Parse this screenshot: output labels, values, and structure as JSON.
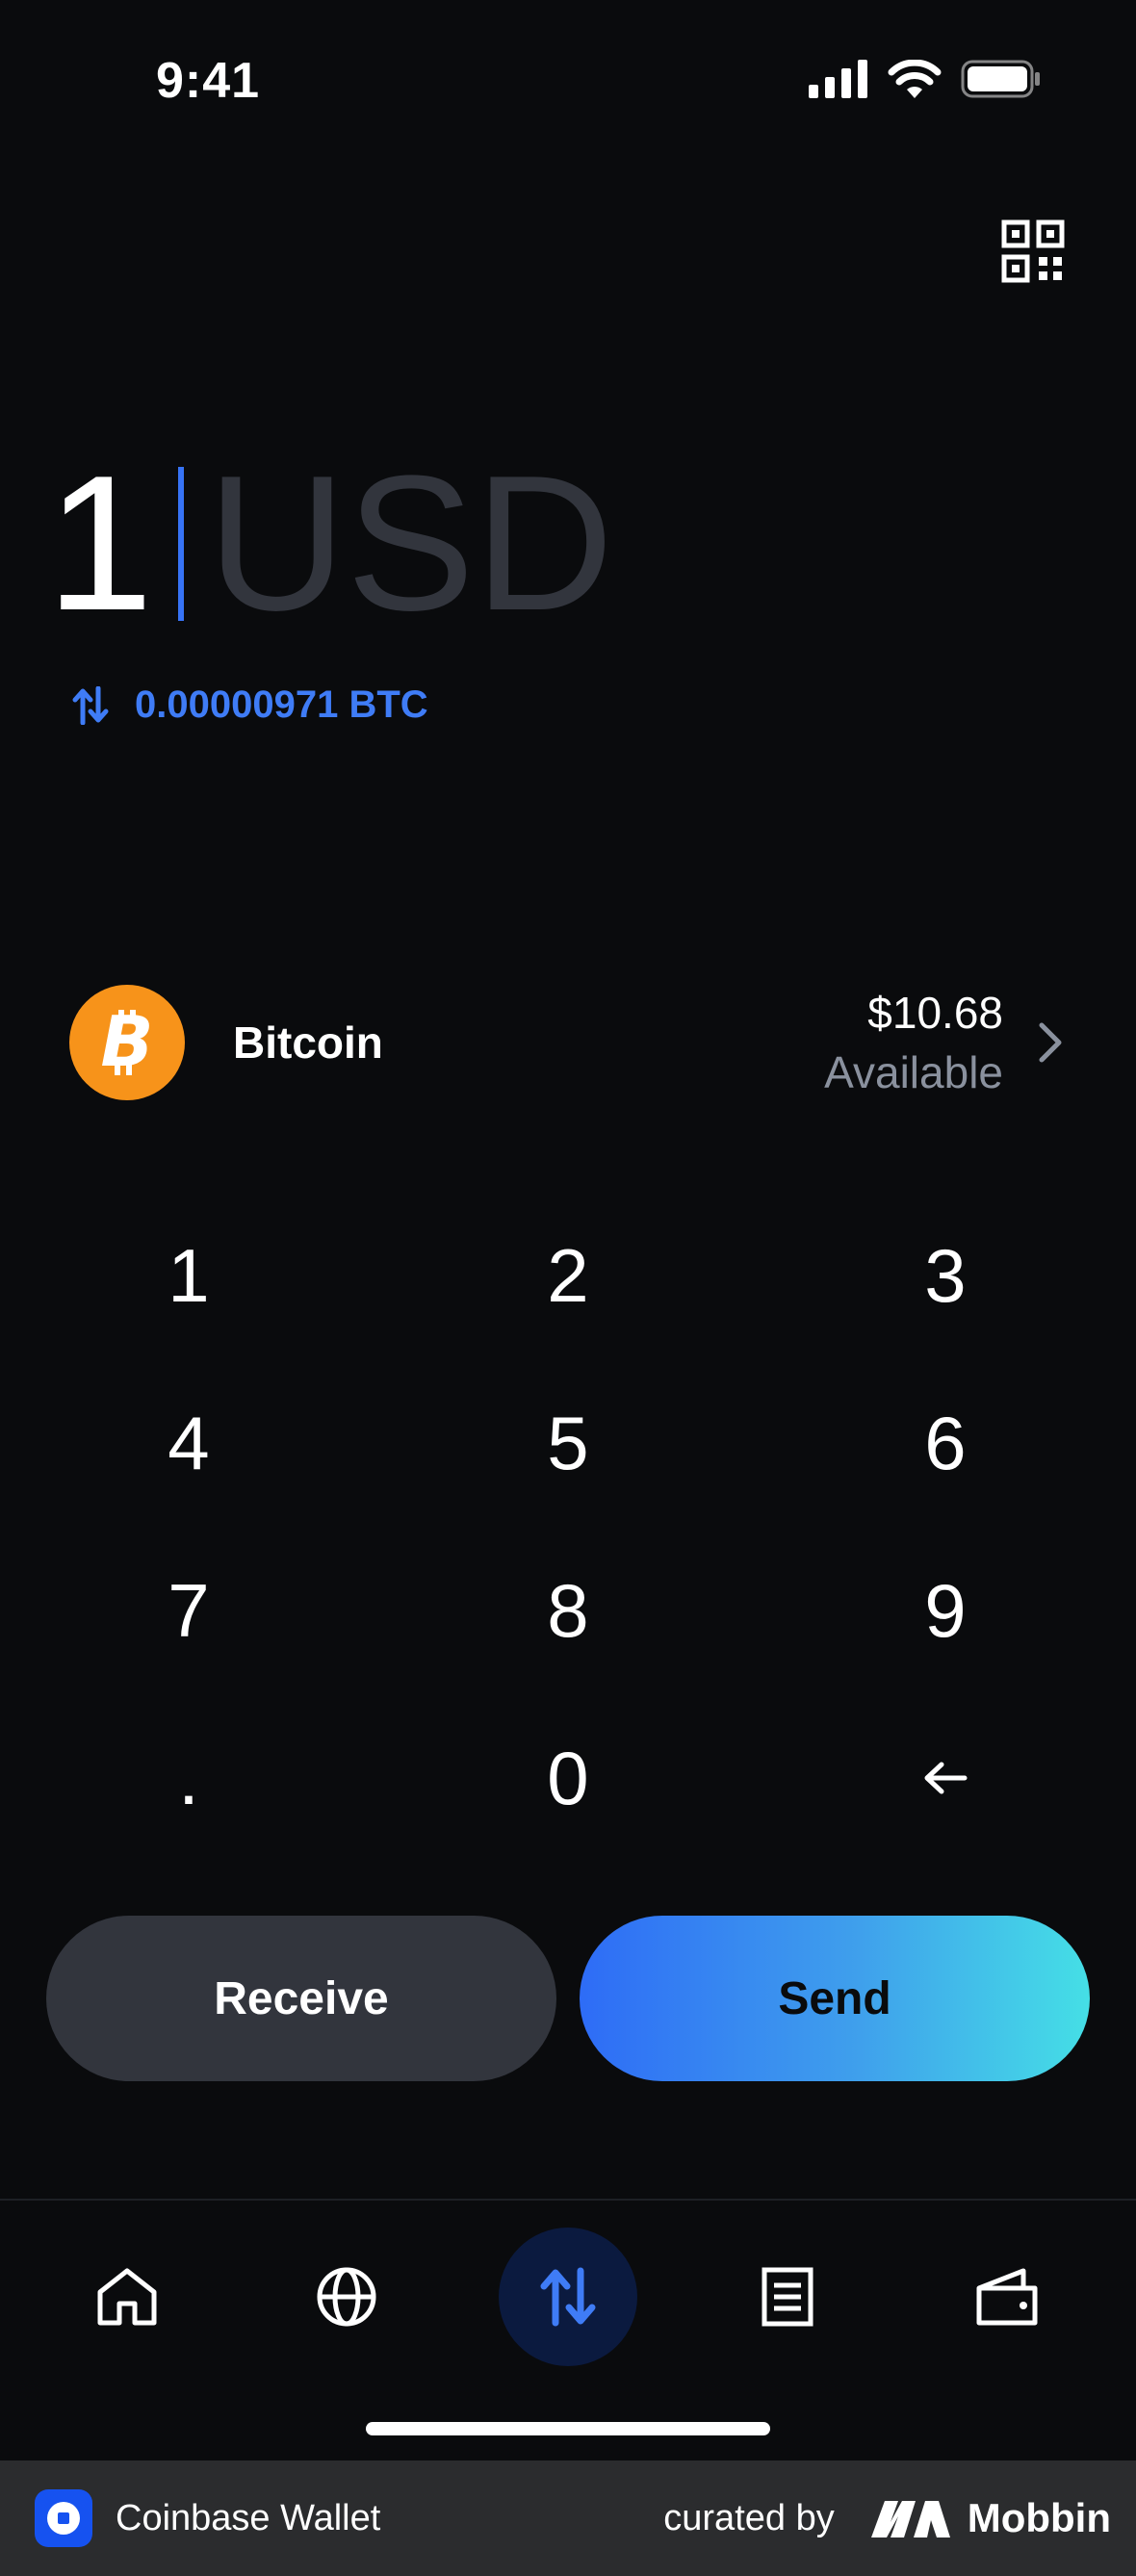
{
  "status_bar": {
    "time": "9:41"
  },
  "amount": {
    "value": "1",
    "unit": "USD"
  },
  "conversion": {
    "text": "0.00000971 BTC"
  },
  "asset": {
    "name": "Bitcoin",
    "balance": "$10.68",
    "available_label": "Available"
  },
  "keypad": {
    "keys": [
      "1",
      "2",
      "3",
      "4",
      "5",
      "6",
      "7",
      "8",
      "9",
      ".",
      "0"
    ]
  },
  "actions": {
    "receive_label": "Receive",
    "send_label": "Send"
  },
  "tabs": [
    {
      "icon": "home-icon"
    },
    {
      "icon": "globe-icon"
    },
    {
      "icon": "swap-icon",
      "active": true
    },
    {
      "icon": "document-icon"
    },
    {
      "icon": "wallet-icon"
    }
  ],
  "footer": {
    "app_name": "Coinbase Wallet",
    "curated_by": "curated by",
    "brand": "Mobbin"
  },
  "colors": {
    "background": "#0a0b0d",
    "accent": "#3773f5",
    "bitcoin": "#f7931a",
    "receive_button": "#32353d"
  }
}
